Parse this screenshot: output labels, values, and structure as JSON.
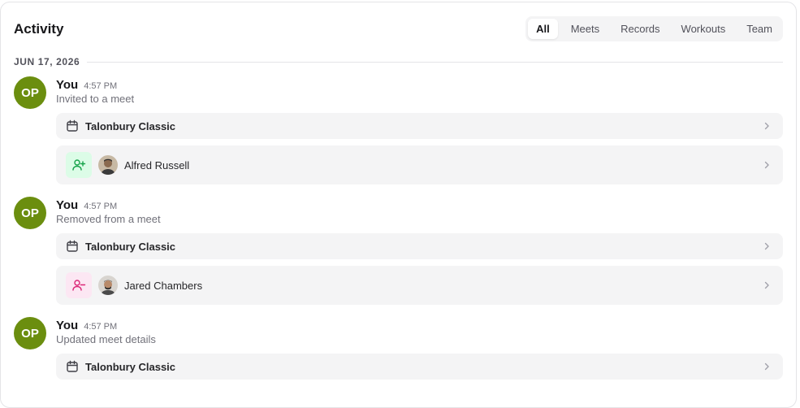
{
  "header": {
    "title": "Activity",
    "tabs": [
      {
        "label": "All",
        "active": true
      },
      {
        "label": "Meets",
        "active": false
      },
      {
        "label": "Records",
        "active": false
      },
      {
        "label": "Workouts",
        "active": false
      },
      {
        "label": "Team",
        "active": false
      }
    ]
  },
  "date_group": "JUN 17, 2026",
  "colors": {
    "avatar_bg": "#6b8e0f",
    "add_badge_bg": "#dcfce7",
    "add_icon": "#16a34a",
    "remove_badge_bg": "#fce7f3",
    "remove_icon": "#db2777",
    "card_bg": "#f4f4f5"
  },
  "entries": [
    {
      "avatar_initials": "OP",
      "actor": "You",
      "time": "4:57 PM",
      "action": "Invited to a meet",
      "meet": {
        "icon": "calendar-icon",
        "name": "Talonbury Classic"
      },
      "person": {
        "badge_icon": "user-plus-icon",
        "name": "Alfred Russell"
      }
    },
    {
      "avatar_initials": "OP",
      "actor": "You",
      "time": "4:57 PM",
      "action": "Removed from a meet",
      "meet": {
        "icon": "calendar-icon",
        "name": "Talonbury Classic"
      },
      "person": {
        "badge_icon": "user-minus-icon",
        "name": "Jared Chambers"
      }
    },
    {
      "avatar_initials": "OP",
      "actor": "You",
      "time": "4:57 PM",
      "action": "Updated meet details",
      "meet": {
        "icon": "calendar-icon",
        "name": "Talonbury Classic"
      }
    }
  ]
}
